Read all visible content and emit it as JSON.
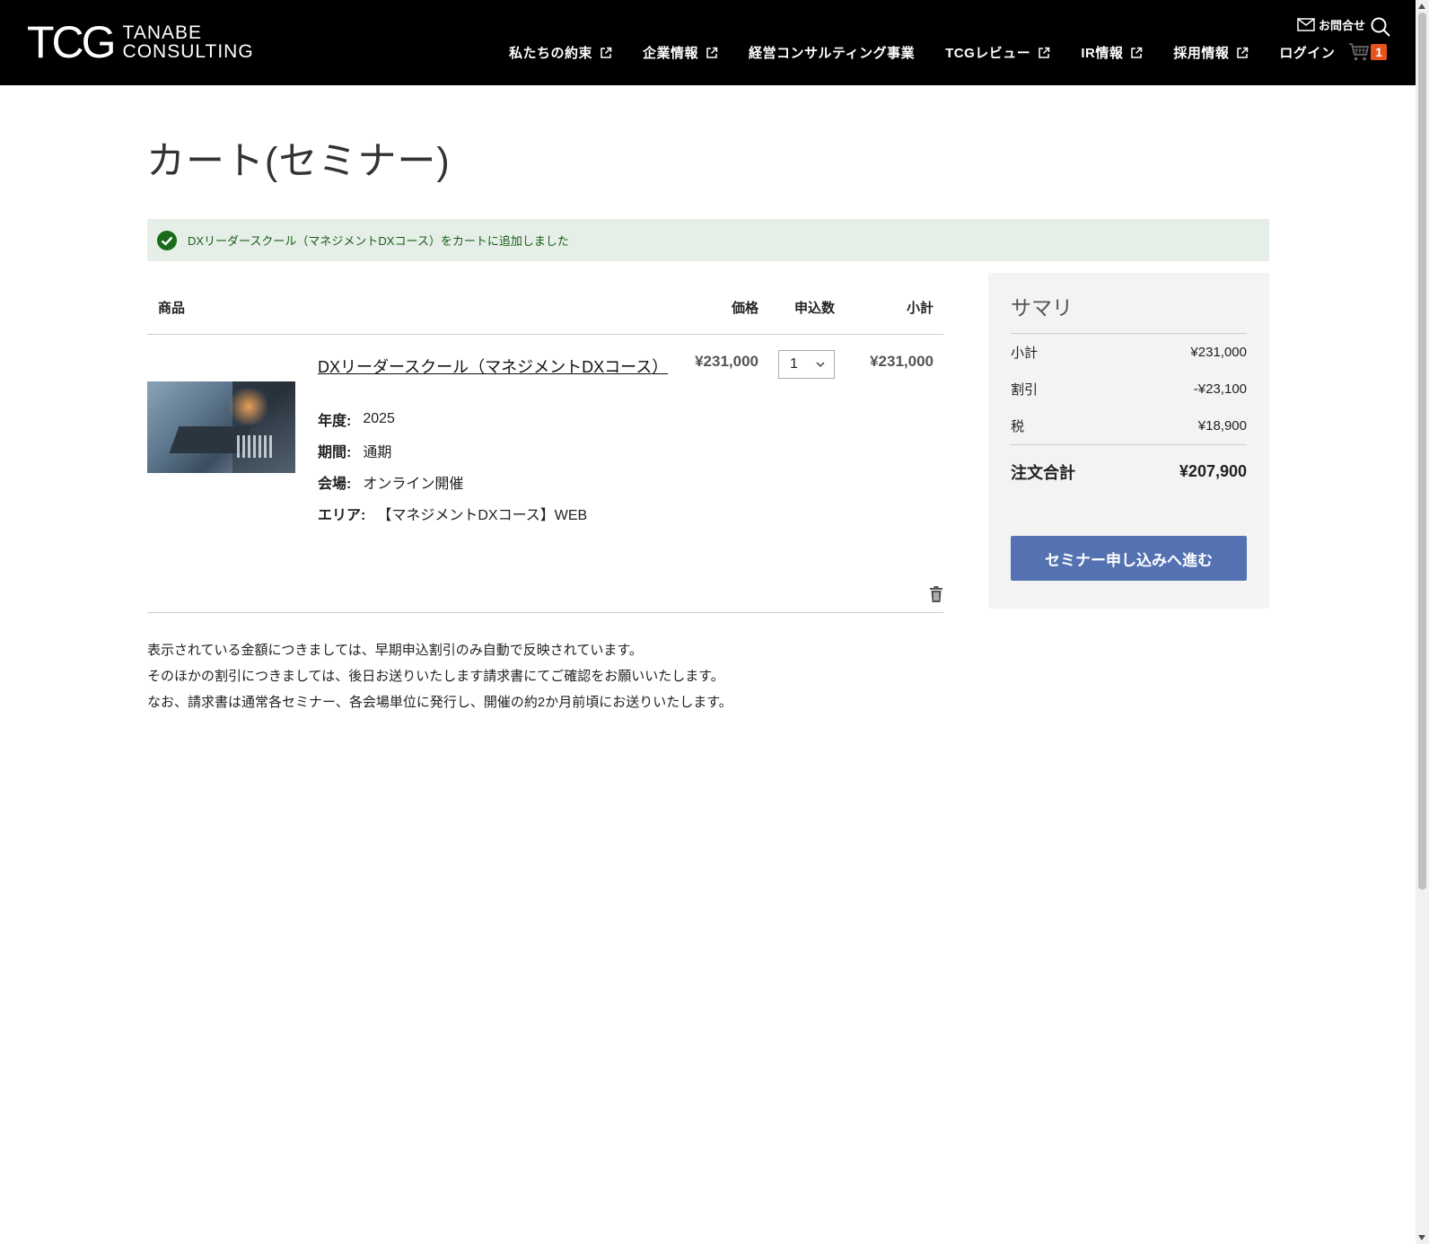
{
  "header": {
    "logo_mark": "TCG",
    "logo_line1": "TANABE",
    "logo_line2": "CONSULTING",
    "contact_label": "お問合せ",
    "nav": [
      {
        "label": "私たちの約束",
        "external": true
      },
      {
        "label": "企業情報",
        "external": true
      },
      {
        "label": "経営コンサルティング事業",
        "external": false
      },
      {
        "label": "TCGレビュー",
        "external": true
      },
      {
        "label": "IR情報",
        "external": true
      },
      {
        "label": "採用情報",
        "external": true
      },
      {
        "label": "ログイン",
        "external": false
      }
    ],
    "cart_count": "1"
  },
  "page": {
    "title": "カート(セミナー)"
  },
  "alert": {
    "message": "DXリーダースクール（マネジメントDXコース）をカートに追加しました"
  },
  "table": {
    "headers": {
      "product": "商品",
      "price": "価格",
      "qty": "申込数",
      "subtotal": "小計"
    },
    "item": {
      "name": "DXリーダースクール（マネジメントDXコース）",
      "price": "¥231,000",
      "qty": "1",
      "subtotal": "¥231,000",
      "options": [
        {
          "label": "年度:",
          "value": "2025"
        },
        {
          "label": "期間:",
          "value": "通期"
        },
        {
          "label": "会場:",
          "value": "オンライン開催"
        },
        {
          "label": "エリア:",
          "value": "【マネジメントDXコース】WEB"
        }
      ]
    }
  },
  "notes": [
    "表示されている金額につきましては、早期申込割引のみ自動で反映されています。",
    "そのほかの割引につきましては、後日お送りいたします請求書にてご確認をお願いいたします。",
    "なお、請求書は通常各セミナー、各会場単位に発行し、開催の約2か月前頃にお送りいたします。"
  ],
  "summary": {
    "title": "サマリ",
    "subtotal_label": "小計",
    "subtotal": "¥231,000",
    "discount_label": "割引",
    "discount": "-¥23,100",
    "tax_label": "税",
    "tax": "¥18,900",
    "total_label": "注文合計",
    "total": "¥207,900",
    "checkout_label": "セミナー申し込みへ進む"
  },
  "colors": {
    "header_bg": "#000000",
    "alert_bg": "#e5efe7",
    "alert_icon": "#1b6b1b",
    "cart_badge": "#e8541e",
    "checkout_button": "#5472b2"
  }
}
